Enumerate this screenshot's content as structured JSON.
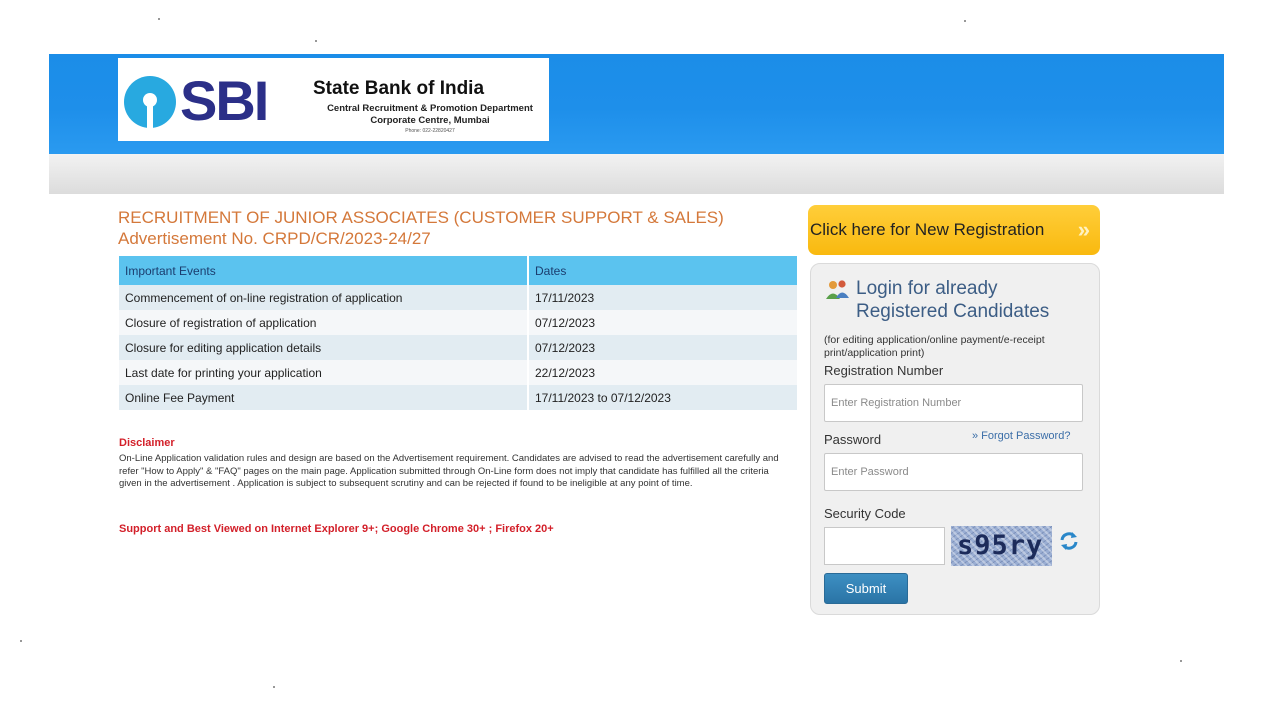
{
  "header": {
    "logo_text": "SBI",
    "bank_name": "State Bank of India",
    "dept_line1": "Central Recruitment & Promotion Department",
    "dept_line2": "Corporate Centre, Mumbai",
    "phone": "Phone: 022-22820427"
  },
  "title": {
    "line1": "RECRUITMENT OF JUNIOR ASSOCIATES (CUSTOMER SUPPORT & SALES)",
    "line2": "Advertisement No. CRPD/CR/2023-24/27"
  },
  "events_table": {
    "headers": [
      "Important Events",
      "Dates"
    ],
    "rows": [
      [
        "Commencement of on-line registration of application",
        "17/11/2023"
      ],
      [
        "Closure of registration of application",
        "07/12/2023"
      ],
      [
        "Closure for editing application details",
        "07/12/2023"
      ],
      [
        "Last date for printing your application",
        "22/12/2023"
      ],
      [
        "Online Fee Payment",
        "17/11/2023 to 07/12/2023"
      ]
    ]
  },
  "disclaimer": {
    "title": "Disclaimer",
    "text": "On-Line Application validation rules and design are based on the Advertisement requirement. Candidates are advised to read the advertisement carefully and refer \"How to Apply\" & \"FAQ\" pages on the main page. Application submitted through On-Line form does not imply that candidate has fulfilled all the criteria given in the advertisement . Application is subject to subsequent scrutiny and can be rejected if found to be ineligible at any point of time."
  },
  "browser_note": "Support and Best Viewed on Internet Explorer 9+; Google Chrome 30+ ; Firefox 20+",
  "new_registration": {
    "label": "Click here for New Registration",
    "chevron": "»"
  },
  "login": {
    "title_line1": "Login for already",
    "title_line2": "Registered Candidates",
    "hint_line1": "(for editing application/online payment/e-receipt",
    "hint_line2": "print/application print)",
    "reg_label": "Registration Number",
    "reg_placeholder": "Enter Registration Number",
    "reg_value": "",
    "password_label": "Password",
    "password_placeholder": "Enter Password",
    "password_value": "",
    "forgot_label": "» Forgot Password?",
    "security_label": "Security Code",
    "security_value": "",
    "captcha_text": "s95ry",
    "submit_label": "Submit"
  },
  "colors": {
    "header_blue": "#1e8fea",
    "title_orange": "#d4783a",
    "table_header": "#5bc3ef",
    "alert_red": "#d3202a",
    "reg_button": "#f9b90f",
    "submit_blue": "#2a74a6"
  }
}
